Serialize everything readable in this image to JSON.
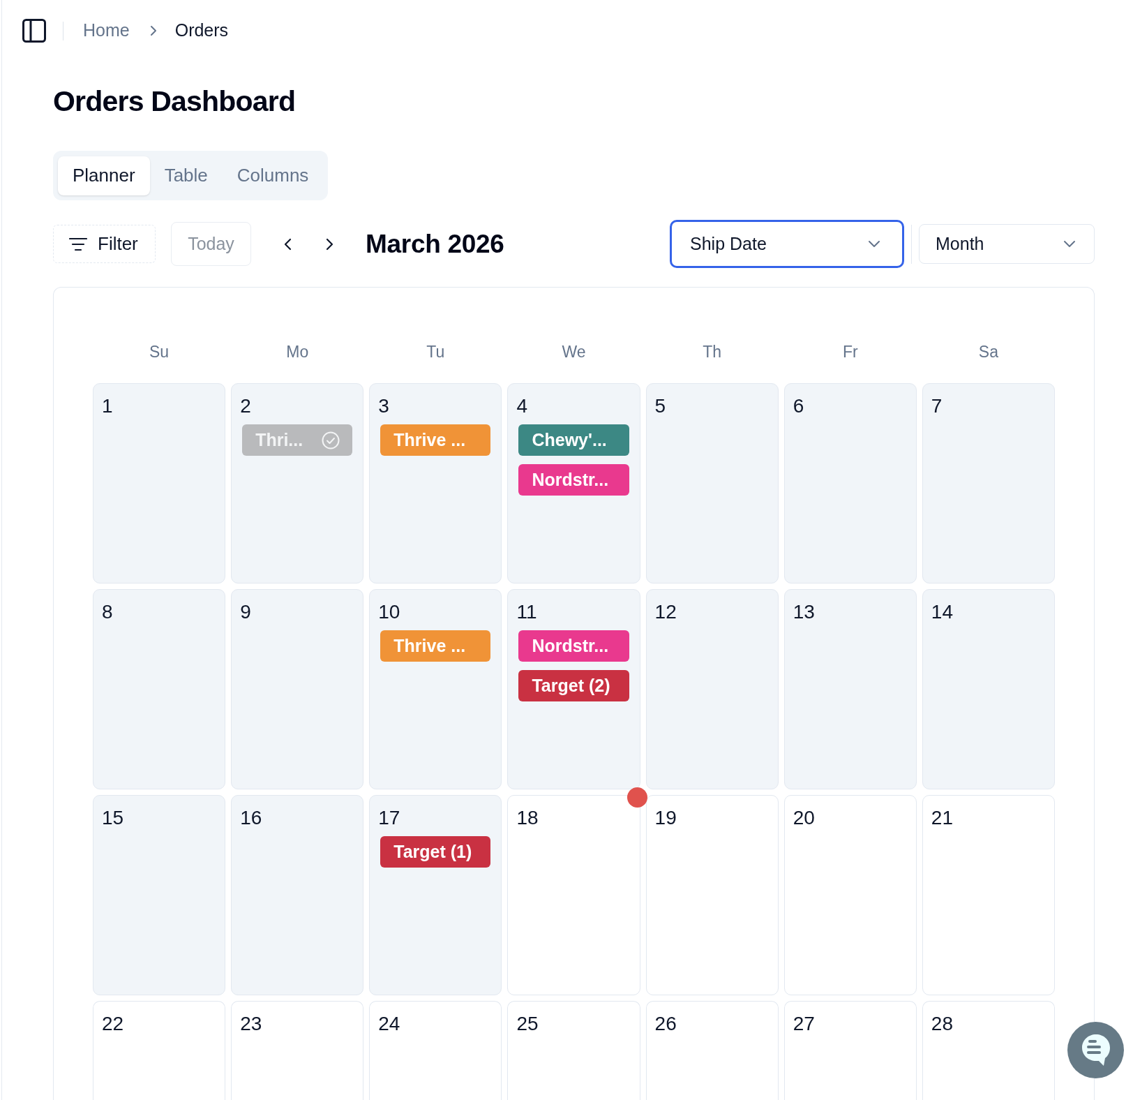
{
  "breadcrumb": [
    {
      "label": "Home",
      "current": false
    },
    {
      "label": "Orders",
      "current": true
    }
  ],
  "title": "Orders Dashboard",
  "tabs": [
    {
      "label": "Planner",
      "selected": true
    },
    {
      "label": "Table",
      "selected": false
    },
    {
      "label": "Columns",
      "selected": false
    }
  ],
  "toolbar": {
    "filter": "Filter",
    "today": "Today",
    "period": "March 2026",
    "selects": [
      {
        "value": "Ship Date",
        "focused": true
      },
      {
        "value": "Month",
        "focused": false
      }
    ]
  },
  "calendar": {
    "weekdays": [
      "Su",
      "Mo",
      "Tu",
      "We",
      "Th",
      "Fr",
      "Sa"
    ],
    "weeks": [
      [
        {
          "day": "1",
          "past": true,
          "marked": false
        },
        {
          "day": "2",
          "past": true,
          "marked": false,
          "events": [
            {
              "label": "Thri...",
              "color": "#b9babc",
              "completed": true
            }
          ]
        },
        {
          "day": "3",
          "past": true,
          "marked": false,
          "events": [
            {
              "label": "Thrive ...",
              "color": "#f09337",
              "completed": false
            }
          ]
        },
        {
          "day": "4",
          "past": true,
          "marked": false,
          "events": [
            {
              "label": "Chewy'...",
              "color": "#3c8884",
              "completed": false
            },
            {
              "label": "Nordstr...",
              "color": "#e9398e",
              "completed": false
            }
          ]
        },
        {
          "day": "5",
          "past": true,
          "marked": false
        },
        {
          "day": "6",
          "past": true,
          "marked": false
        },
        {
          "day": "7",
          "past": true,
          "marked": false
        }
      ],
      [
        {
          "day": "8",
          "past": true,
          "marked": false
        },
        {
          "day": "9",
          "past": true,
          "marked": false
        },
        {
          "day": "10",
          "past": true,
          "marked": false,
          "events": [
            {
              "label": "Thrive ...",
              "color": "#f09337",
              "completed": false
            }
          ]
        },
        {
          "day": "11",
          "past": true,
          "marked": false,
          "events": [
            {
              "label": "Nordstr...",
              "color": "#e9398e",
              "completed": false
            },
            {
              "label": "Target (2)",
              "color": "#c93142",
              "completed": false
            }
          ]
        },
        {
          "day": "12",
          "past": true,
          "marked": false
        },
        {
          "day": "13",
          "past": true,
          "marked": false
        },
        {
          "day": "14",
          "past": true,
          "marked": false
        }
      ],
      [
        {
          "day": "15",
          "past": true,
          "marked": false
        },
        {
          "day": "16",
          "past": true,
          "marked": false
        },
        {
          "day": "17",
          "past": true,
          "marked": false,
          "events": [
            {
              "label": "Target (1)",
              "color": "#c93142",
              "completed": false
            }
          ]
        },
        {
          "day": "18",
          "past": false,
          "marked": true
        },
        {
          "day": "19",
          "past": false,
          "marked": false
        },
        {
          "day": "20",
          "past": false,
          "marked": false
        },
        {
          "day": "21",
          "past": false,
          "marked": false
        }
      ],
      [
        {
          "day": "22",
          "past": false,
          "marked": false
        },
        {
          "day": "23",
          "past": false,
          "marked": false
        },
        {
          "day": "24",
          "past": false,
          "marked": false
        },
        {
          "day": "25",
          "past": false,
          "marked": false
        },
        {
          "day": "26",
          "past": false,
          "marked": false
        },
        {
          "day": "27",
          "past": false,
          "marked": false
        },
        {
          "day": "28",
          "past": false,
          "marked": false
        }
      ]
    ]
  }
}
